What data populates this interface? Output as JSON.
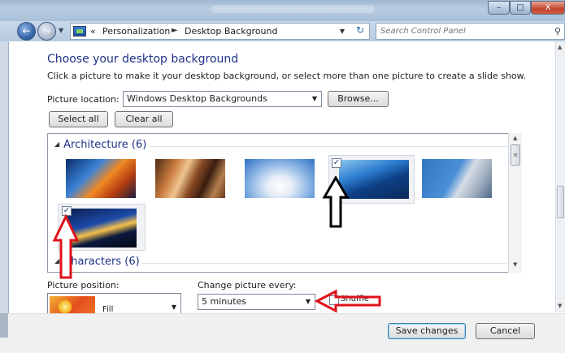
{
  "window": {
    "minimize_glyph": "–",
    "maximize_glyph": "□",
    "close_glyph": "X"
  },
  "nav": {
    "back_glyph": "←",
    "forward_glyph": "→",
    "dropdown_glyph": "▼",
    "breadcrumb": {
      "overflow": "«",
      "items": [
        "Personalization",
        "Desktop Background"
      ],
      "separator": "►"
    },
    "refresh_glyph": "↻",
    "search_placeholder": "Search Control Panel",
    "search_glyph": "⚲"
  },
  "page": {
    "heading": "Choose your desktop background",
    "subtext": "Click a picture to make it your desktop background, or select more than one picture to create a slide show.",
    "picture_location_label": "Picture location:",
    "picture_location_value": "Windows Desktop Backgrounds",
    "browse_label": "Browse...",
    "select_all_label": "Select all",
    "clear_all_label": "Clear all"
  },
  "gallery": {
    "groups": [
      {
        "name": "Architecture (6)"
      },
      {
        "name": "Characters (6)"
      }
    ],
    "thumbnails": [
      {
        "checked": false
      },
      {
        "checked": false
      },
      {
        "checked": false
      },
      {
        "checked": true
      },
      {
        "checked": false
      },
      {
        "checked": true
      }
    ],
    "check_glyph": "✓"
  },
  "bottom": {
    "picture_position_label": "Picture position:",
    "picture_position_value": "Fill",
    "change_every_label": "Change picture every:",
    "change_every_value": "5 minutes",
    "shuffle_label": "Shuffle",
    "shuffle_checked": false
  },
  "footer": {
    "save_label": "Save changes",
    "cancel_label": "Cancel"
  },
  "colors": {
    "heading": "#1e3287",
    "annotation_red": "#e0121b",
    "annotation_black": "#000000"
  }
}
